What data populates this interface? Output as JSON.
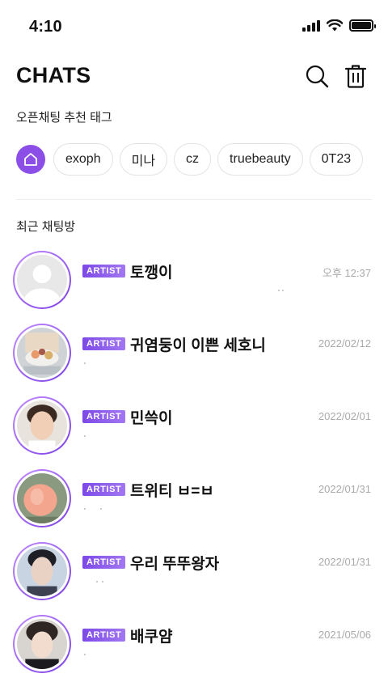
{
  "status_bar": {
    "time": "4:10"
  },
  "header": {
    "title": "CHATS"
  },
  "tags": {
    "heading": "오픈채팅 추천 태그",
    "items": [
      "exoph",
      "미나",
      "cz",
      "truebeauty",
      "0T23"
    ]
  },
  "recent": {
    "heading": "최근 채팅방"
  },
  "chats": [
    {
      "badge": "ARTIST",
      "name": "토깽이",
      "time": "오후 12:37"
    },
    {
      "badge": "ARTIST",
      "name": "귀염둥이 이쁜 세호니",
      "time": "2022/02/12"
    },
    {
      "badge": "ARTIST",
      "name": "민쓱이",
      "time": "2022/02/01"
    },
    {
      "badge": "ARTIST",
      "name": "트위티 ㅂ=ㅂ",
      "time": "2022/01/31"
    },
    {
      "badge": "ARTIST",
      "name": "우리 뚜뚜왕자",
      "time": "2022/01/31"
    },
    {
      "badge": "ARTIST",
      "name": "배쿠얌",
      "time": "2021/05/06"
    }
  ],
  "colors": {
    "accent": "#8b4fe8",
    "time_text": "#aaaaaa",
    "chip_border": "#e3e3e3"
  },
  "icons": {
    "search": "search-icon",
    "trash": "trash-icon",
    "home": "home-icon"
  }
}
